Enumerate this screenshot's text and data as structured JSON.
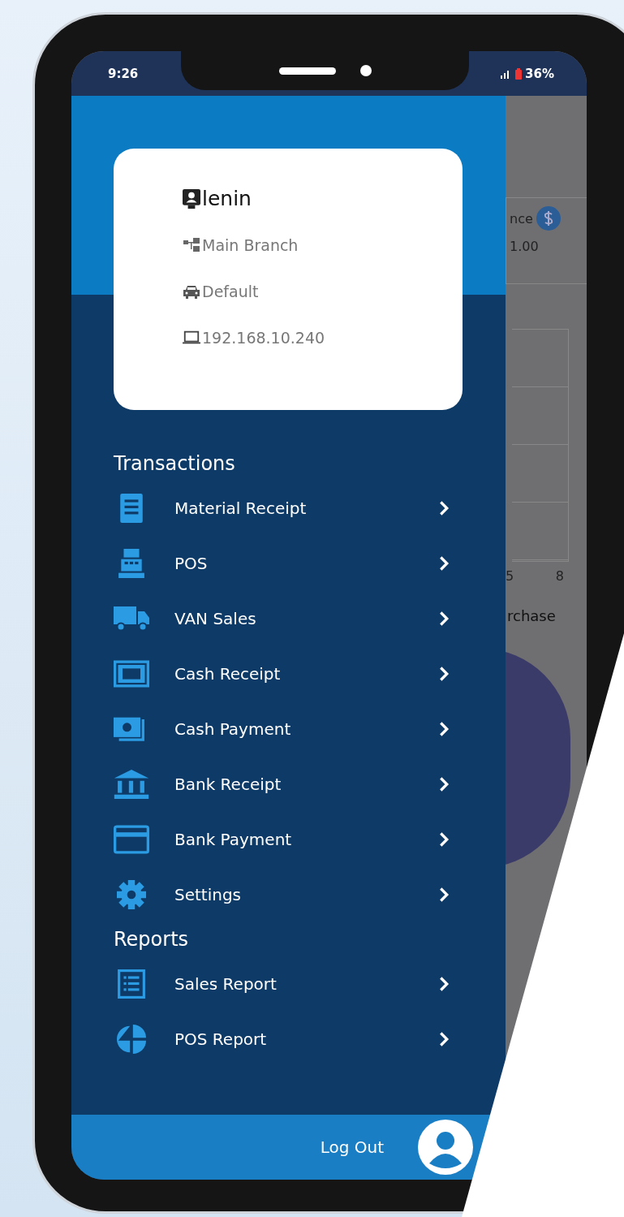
{
  "status_bar": {
    "time": "9:26",
    "battery": "36%"
  },
  "profile": {
    "user": "lenin",
    "branch": "Main Branch",
    "vehicle": "Default",
    "ip": "192.168.10.240"
  },
  "sections": [
    {
      "title": "Transactions",
      "items": [
        {
          "label": "Material Receipt"
        },
        {
          "label": "POS"
        },
        {
          "label": "VAN Sales"
        },
        {
          "label": "Cash Receipt"
        },
        {
          "label": "Cash Payment"
        },
        {
          "label": "Bank Receipt"
        },
        {
          "label": "Bank Payment"
        },
        {
          "label": "Settings"
        }
      ]
    },
    {
      "title": "Reports",
      "items": [
        {
          "label": "Sales Report"
        },
        {
          "label": "POS Report"
        }
      ]
    }
  ],
  "logout": {
    "label": "Log Out"
  },
  "background_app": {
    "card_label": "nce",
    "card_value": "1.00",
    "axis_labels": [
      "5",
      "8"
    ],
    "section_title": "rchase"
  }
}
